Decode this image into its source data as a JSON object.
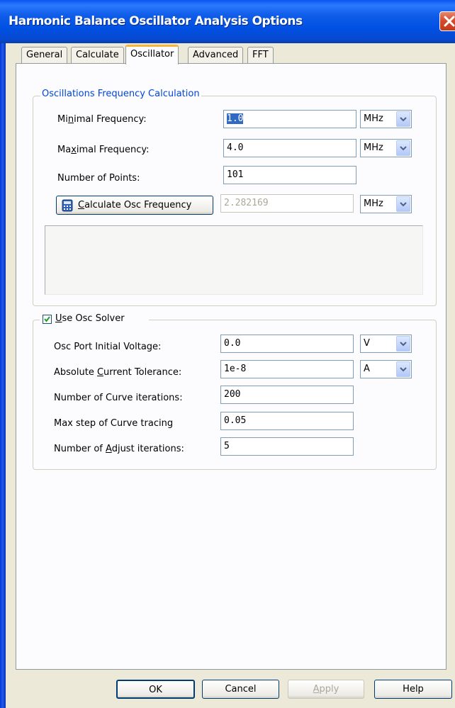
{
  "window": {
    "title": "Harmonic Balance Oscillator Analysis Options"
  },
  "tabs": [
    {
      "label": "General"
    },
    {
      "label": "Calculate"
    },
    {
      "label": "Oscillator",
      "active": true
    },
    {
      "label": "Advanced"
    },
    {
      "label": "FFT"
    }
  ],
  "freq_group": {
    "legend": "Oscillations Frequency Calculation",
    "min_freq": {
      "label_pre": "Mi",
      "label_u": "n",
      "label_post": "imal Frequency:",
      "value": "1.0",
      "unit": "MHz"
    },
    "max_freq": {
      "label_pre": "Ma",
      "label_u": "x",
      "label_post": "imal Frequency:",
      "value": "4.0",
      "unit": "MHz"
    },
    "num_points": {
      "label": "Number of Points:",
      "value": "101"
    },
    "calc_button": {
      "label_u": "C",
      "label_post": "alculate Osc Frequency"
    },
    "result": {
      "value": "2.282169",
      "unit": "MHz"
    }
  },
  "solver_group": {
    "checkbox_label_u": "U",
    "checkbox_label_post": "se Osc Solver",
    "checked": true,
    "port_voltage": {
      "label": "Osc Port Initial Voltage:",
      "value": "0.0",
      "unit": "V"
    },
    "abs_current_tol": {
      "label_pre": "Absolute ",
      "label_u": "C",
      "label_post": "urrent Tolerance:",
      "value": "1e-8",
      "unit": "A"
    },
    "curve_iterations": {
      "label": "Number of Curve iterations:",
      "value": "200"
    },
    "max_step": {
      "label": "Max step of Curve tracing",
      "value": "0.05"
    },
    "adjust_iterations": {
      "label_pre": "Number of ",
      "label_u": "A",
      "label_post": "djust iterations:",
      "value": "5"
    }
  },
  "buttons": {
    "ok": "OK",
    "cancel": "Cancel",
    "apply_u": "A",
    "apply_post": "pply",
    "help": "Help"
  },
  "colors": {
    "titlebar": "#0054e3",
    "active_tab_accent": "#f8b439",
    "dialog_bg": "#ece9d8",
    "selection": "#316ac5",
    "checkmark": "#21a121"
  }
}
